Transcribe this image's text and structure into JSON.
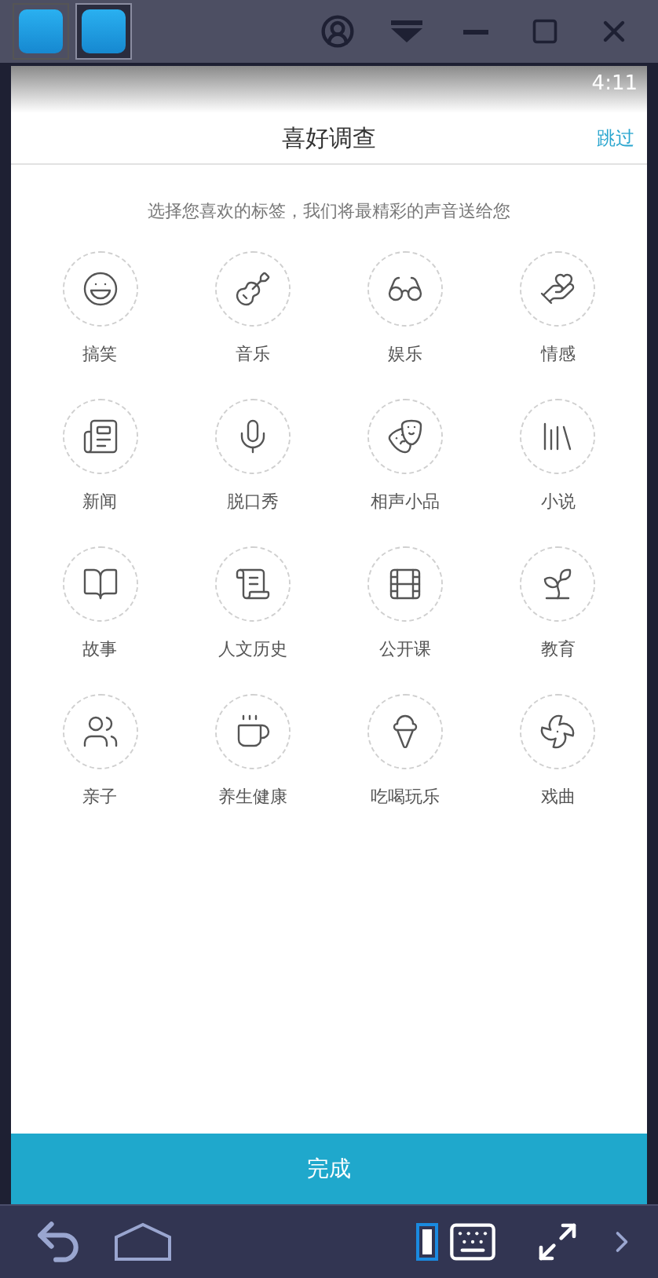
{
  "window": {
    "tabs": [
      {
        "selected": false
      },
      {
        "selected": true
      }
    ]
  },
  "status_bar": {
    "time": "4:11"
  },
  "header": {
    "title": "喜好调查",
    "skip": "跳过"
  },
  "subtitle": "选择您喜欢的标签，我们将最精彩的声音送给您",
  "categories": [
    {
      "label": "搞笑",
      "selected": false
    },
    {
      "label": "音乐",
      "selected": false
    },
    {
      "label": "娱乐",
      "selected": false
    },
    {
      "label": "情感",
      "selected": false
    },
    {
      "label": "新闻",
      "selected": false
    },
    {
      "label": "脱口秀",
      "selected": false
    },
    {
      "label": "相声小品",
      "selected": false
    },
    {
      "label": "小说",
      "selected": false
    },
    {
      "label": "故事",
      "selected": false
    },
    {
      "label": "人文历史",
      "selected": false
    },
    {
      "label": "公开课",
      "selected": false
    },
    {
      "label": "教育",
      "selected": false
    },
    {
      "label": "亲子",
      "selected": false
    },
    {
      "label": "养生健康",
      "selected": false
    },
    {
      "label": "吃喝玩乐",
      "selected": false
    },
    {
      "label": "戏曲",
      "selected": false
    }
  ],
  "done_button": "完成",
  "nav_bar": {
    "portrait_selected": true
  }
}
